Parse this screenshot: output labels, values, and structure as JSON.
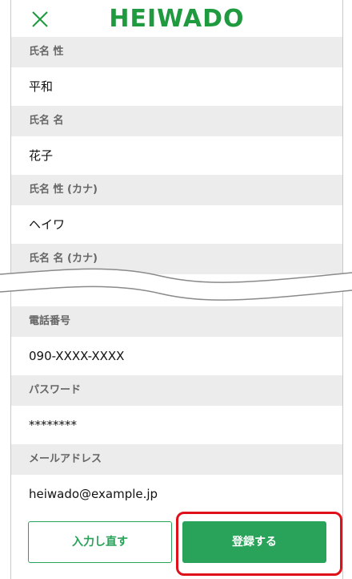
{
  "header": {
    "logo_text": "HEIWADO"
  },
  "fields": [
    {
      "label": "氏名 性",
      "value": "平和"
    },
    {
      "label": "氏名 名",
      "value": "花子"
    },
    {
      "label": "氏名 性 (カナ)",
      "value": "ヘイワ"
    },
    {
      "label": "氏名 名 (カナ)",
      "value": ""
    },
    {
      "label": "電話番号",
      "value": "090-XXXX-XXXX"
    },
    {
      "label": "パスワード",
      "value": "********"
    },
    {
      "label": "メールアドレス",
      "value": "heiwado@example.jp"
    }
  ],
  "buttons": {
    "reset_label": "入力し直す",
    "submit_label": "登録する"
  },
  "colors": {
    "brand_green": "#1f9a3f",
    "button_green": "#2aa35a",
    "label_bg": "#ececec",
    "highlight_red": "#e0101a"
  },
  "icons": {
    "close": "close-icon"
  }
}
